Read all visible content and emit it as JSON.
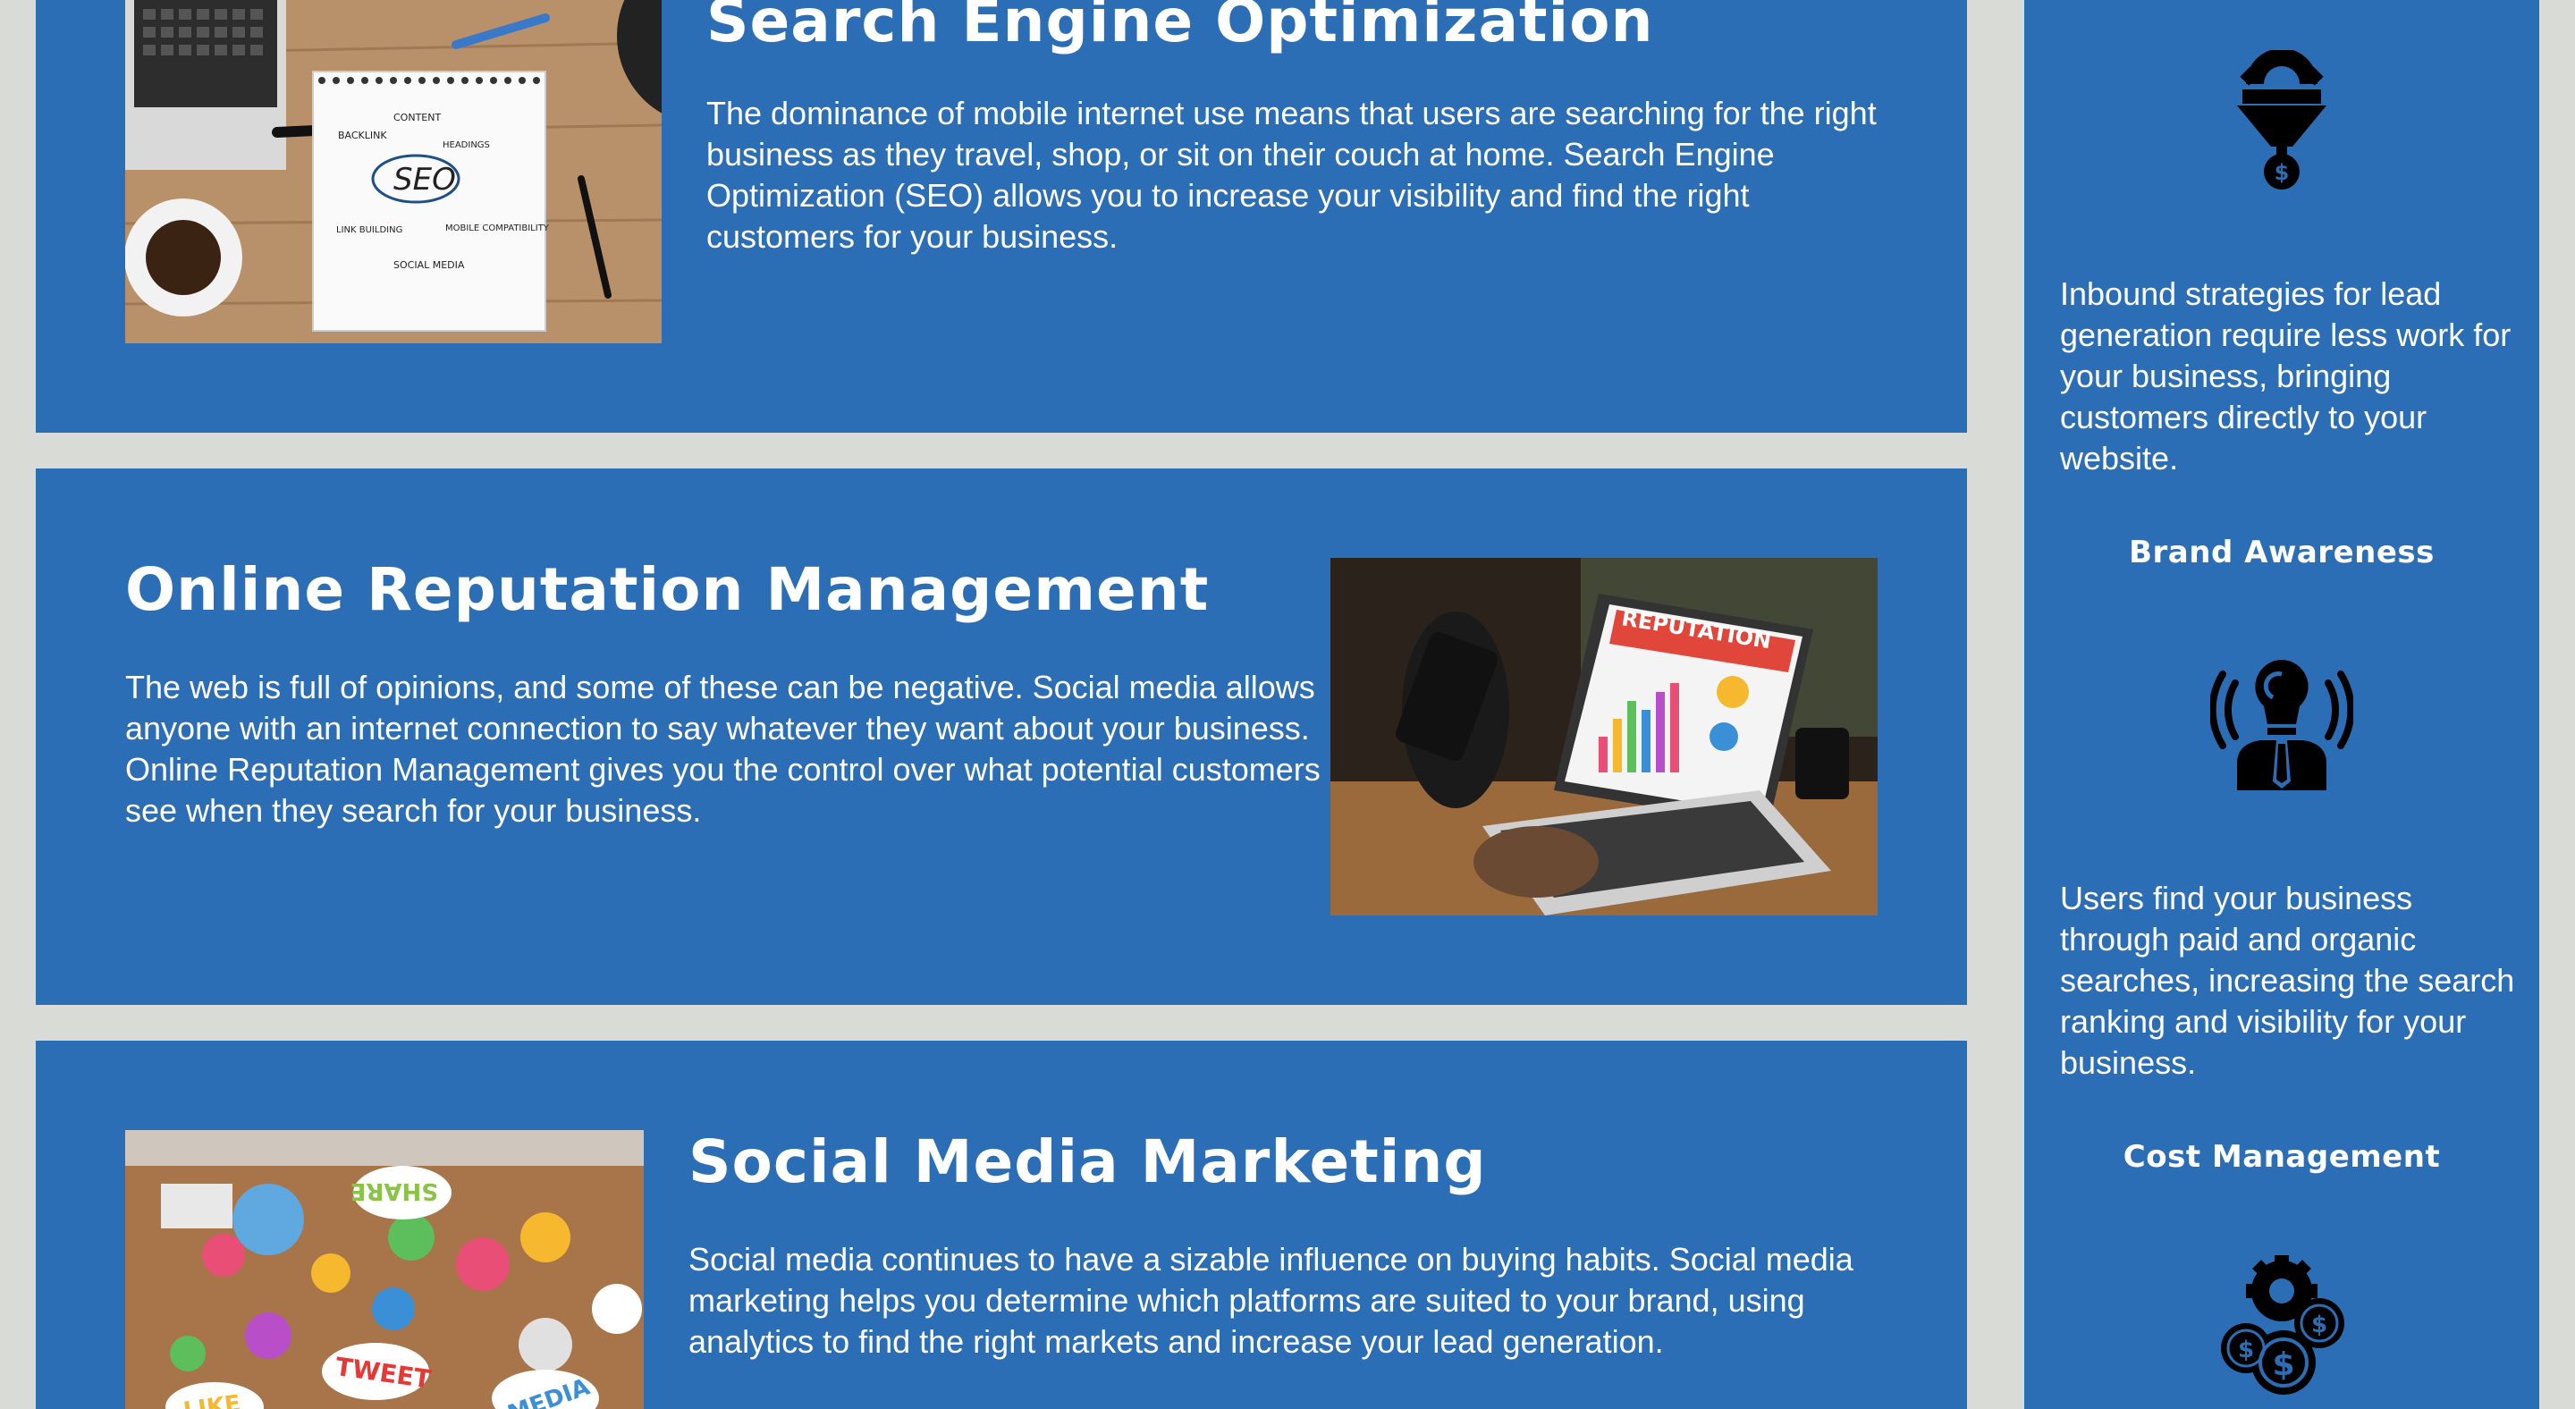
{
  "services": {
    "seo": {
      "title": "Search Engine Optimization",
      "text": "The dominance of mobile internet use means that users are searching for the right business as they travel, shop, or sit on their couch at home. Search Engine Optimization (SEO) allows you to increase your visibility and find the right customers for your business.",
      "image_labels": [
        "CONTENT",
        "BACKLINK",
        "HEADINGS",
        "SEO",
        "LINK BUILDING",
        "MOBILE COMPATIBILITY",
        "SOCIAL MEDIA"
      ]
    },
    "orm": {
      "title": "Online Reputation Management",
      "text": "The web is full of opinions, and some of these can be negative. Social media allows anyone with an internet connection to say whatever they want about your business. Online Reputation Management gives you the control over what potential customers see when they search for your business.",
      "image_label": "REPUTATION"
    },
    "smm": {
      "title": "Social Media Marketing",
      "text": "Social media continues to have a sizable influence on buying habits. Social media marketing helps you determine which platforms are suited to your brand, using analytics to find the right markets and increase your lead generation.",
      "image_labels": [
        "SHARE",
        "TWEET",
        "LIKE",
        "MEDIA"
      ]
    }
  },
  "sidebar": {
    "lead": {
      "icon": "funnel-gear-dollar-icon",
      "text": "Inbound strategies for lead generation require less work for your business, bringing customers directly to your website."
    },
    "brand": {
      "heading": "Brand Awareness",
      "icon": "lightbulb-person-icon",
      "text": "Users find your business through paid and organic searches, increasing the search ranking and visibility for your business."
    },
    "cost": {
      "heading": "Cost Management",
      "icon": "gear-coins-icon"
    }
  },
  "colors": {
    "page_background": "#d9dcd6",
    "card_background": "#2c6eb5",
    "text": "#ffffff",
    "icon": "#000000"
  }
}
